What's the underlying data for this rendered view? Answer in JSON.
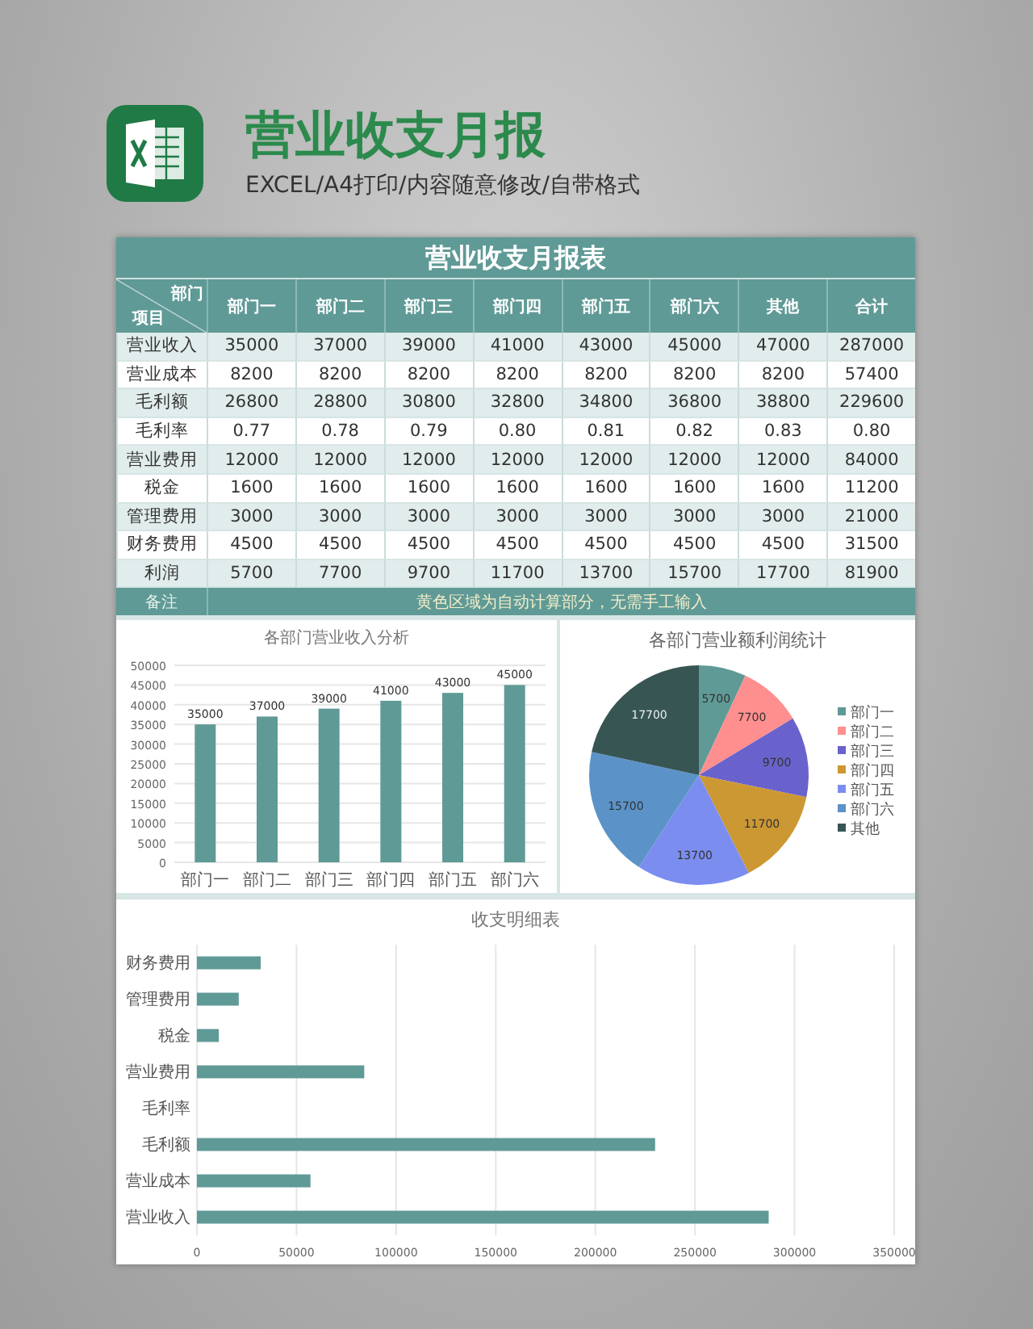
{
  "header": {
    "title": "营业收支月报",
    "subtitle": "EXCEL/A4打印/内容随意修改/自带格式"
  },
  "table": {
    "title": "营业收支月报表",
    "corner_top": "部门",
    "corner_bottom": "项目",
    "columns": [
      "部门一",
      "部门二",
      "部门三",
      "部门四",
      "部门五",
      "部门六",
      "其他",
      "合计"
    ],
    "rows": [
      {
        "label": "营业收入",
        "cells": [
          "35000",
          "37000",
          "39000",
          "41000",
          "43000",
          "45000",
          "47000",
          "287000"
        ]
      },
      {
        "label": "营业成本",
        "cells": [
          "8200",
          "8200",
          "8200",
          "8200",
          "8200",
          "8200",
          "8200",
          "57400"
        ]
      },
      {
        "label": "毛利额",
        "cells": [
          "26800",
          "28800",
          "30800",
          "32800",
          "34800",
          "36800",
          "38800",
          "229600"
        ]
      },
      {
        "label": "毛利率",
        "cells": [
          "0.77",
          "0.78",
          "0.79",
          "0.80",
          "0.81",
          "0.82",
          "0.83",
          "0.80"
        ]
      },
      {
        "label": "营业费用",
        "cells": [
          "12000",
          "12000",
          "12000",
          "12000",
          "12000",
          "12000",
          "12000",
          "84000"
        ]
      },
      {
        "label": "税金",
        "cells": [
          "1600",
          "1600",
          "1600",
          "1600",
          "1600",
          "1600",
          "1600",
          "11200"
        ]
      },
      {
        "label": "管理费用",
        "cells": [
          "3000",
          "3000",
          "3000",
          "3000",
          "3000",
          "3000",
          "3000",
          "21000"
        ]
      },
      {
        "label": "财务费用",
        "cells": [
          "4500",
          "4500",
          "4500",
          "4500",
          "4500",
          "4500",
          "4500",
          "31500"
        ]
      },
      {
        "label": "利润",
        "cells": [
          "5700",
          "7700",
          "9700",
          "11700",
          "13700",
          "15700",
          "17700",
          "81900"
        ]
      }
    ],
    "note": {
      "label": "备注",
      "text": "黄色区域为自动计算部分，无需手工输入"
    }
  },
  "bar_chart": {
    "chart_data": {
      "type": "bar",
      "title": "各部门营业收入分析",
      "categories": [
        "部门一",
        "部门二",
        "部门三",
        "部门四",
        "部门五",
        "部门六"
      ],
      "series": [
        {
          "color": "#5f9a96",
          "values": [
            35000,
            37000,
            39000,
            41000,
            43000,
            45000
          ]
        }
      ],
      "grid": true,
      "ylim": [
        0,
        50000
      ],
      "yticks": [
        0,
        5000,
        10000,
        15000,
        20000,
        25000,
        30000,
        35000,
        40000,
        45000,
        50000
      ],
      "value_labels": [
        "35000",
        "37000",
        "39000",
        "41000",
        "43000",
        "45000"
      ]
    }
  },
  "pie_chart": {
    "chart_data": {
      "type": "pie",
      "title": "各部门营业额利润统计",
      "categories": [
        "部门一",
        "部门二",
        "部门三",
        "部门四",
        "部门五",
        "部门六",
        "其他"
      ],
      "values": [
        5700,
        7700,
        9700,
        11700,
        13700,
        15700,
        17700
      ],
      "colors": [
        "#5f9a96",
        "#ff8f8f",
        "#6a62cc",
        "#cc9833",
        "#7b8ef0",
        "#5b93c8",
        "#375553"
      ],
      "legend": true,
      "value_labels": [
        "5700",
        "7700",
        "9700",
        "11700",
        "13700",
        "15700",
        "17700"
      ]
    }
  },
  "detail_chart": {
    "chart_data": {
      "type": "bar",
      "orientation": "horizontal",
      "title": "收支明细表",
      "categories": [
        "财务费用",
        "管理费用",
        "税金",
        "营业费用",
        "毛利率",
        "毛利额",
        "营业成本",
        "营业收入"
      ],
      "series": [
        {
          "color": "#5f9a96",
          "values": [
            32000,
            21000,
            11000,
            84000,
            0,
            230000,
            57000,
            287000
          ]
        }
      ],
      "grid": true,
      "xlim": [
        0,
        350000
      ],
      "xticks": [
        0,
        50000,
        100000,
        150000,
        200000,
        250000,
        300000,
        350000
      ]
    }
  }
}
